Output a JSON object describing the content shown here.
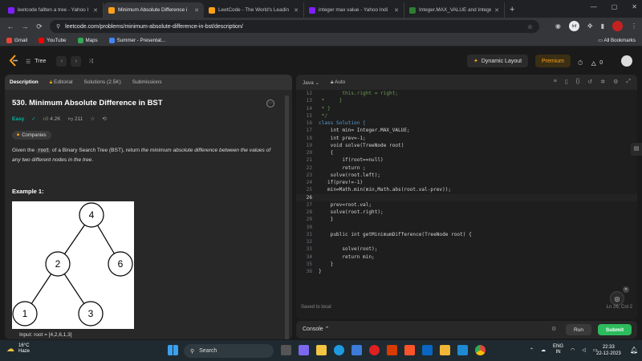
{
  "browser": {
    "tabs": [
      {
        "title": "leetcode fallten a tree - Yahoo I",
        "favicon_color": "#7e1fff",
        "active": false
      },
      {
        "title": "Minimum Absolute Difference i",
        "favicon_color": "#ffa116",
        "active": true
      },
      {
        "title": "LeetCode - The World's Leadin",
        "favicon_color": "#ffa116",
        "active": false
      },
      {
        "title": "integer max value - Yahoo Indi",
        "favicon_color": "#7e1fff",
        "active": false
      },
      {
        "title": "Integer.MAX_VALUE and Intege",
        "favicon_color": "#2e7d32",
        "active": false
      }
    ],
    "new_tab": "+",
    "url": "leetcode.com/problems/minimum-absolute-difference-in-bst/description/",
    "bookmarks": [
      "Gmail",
      "YouTube",
      "Maps",
      "Summer - Presentat..."
    ],
    "all_bookmarks": "All Bookmarks",
    "profile_initials": "Inf"
  },
  "header": {
    "problem_list": "Tree",
    "dynamic_layout": "Dynamic Layout",
    "premium": "Premium",
    "coins": "0"
  },
  "left": {
    "tabs": [
      "Description",
      "Editorial",
      "Solutions (2.5K)",
      "Submissions"
    ],
    "title": "530. Minimum Absolute Difference in BST",
    "difficulty": "Easy",
    "likes": "4.2K",
    "dislikes": "211",
    "companies": "Companies",
    "desc_pre": "Given the ",
    "desc_code": "root",
    "desc_mid": " of a Binary Search Tree (BST), return ",
    "desc_em": "the minimum absolute difference between the values of any two different nodes in the tree",
    "desc_post": ".",
    "example_title": "Example 1:",
    "tree_nodes": [
      "4",
      "2",
      "6",
      "1",
      "3"
    ],
    "input_peek": "Input: root = [4,2,6,1,3]"
  },
  "editor": {
    "language": "Java",
    "mode": "Auto",
    "saved": "Saved to local",
    "cursor": "Ln 26, Col 2",
    "lines": [
      {
        "n": "12",
        "t": "        this.right = right;",
        "c": "cm"
      },
      {
        "n": "13",
        "t": " *     }",
        "c": "cm"
      },
      {
        "n": "14",
        "t": " * }",
        "c": "cm"
      },
      {
        "n": "15",
        "t": " */",
        "c": "cm"
      },
      {
        "n": "16",
        "t": "class Solution {",
        "c": "kw"
      },
      {
        "n": "17",
        "t": "    int min= Integer.MAX_VALUE;",
        "c": "tx"
      },
      {
        "n": "18",
        "t": "    int prev=-1;",
        "c": "tx"
      },
      {
        "n": "19",
        "t": "    void solve(TreeNode root)",
        "c": "tx"
      },
      {
        "n": "20",
        "t": "    {",
        "c": "tx"
      },
      {
        "n": "21",
        "t": "        if(root==null)",
        "c": "tx"
      },
      {
        "n": "22",
        "t": "        return ;",
        "c": "tx"
      },
      {
        "n": "23",
        "t": "    solve(root.left);",
        "c": "tx"
      },
      {
        "n": "24",
        "t": "   if(prev!=-1)",
        "c": "tx"
      },
      {
        "n": "25",
        "t": "   min=Math.min(min,Math.abs(root.val-prev));",
        "c": "tx"
      },
      {
        "n": "26",
        "t": "",
        "c": "tx"
      },
      {
        "n": "27",
        "t": "    prev=root.val;",
        "c": "tx"
      },
      {
        "n": "28",
        "t": "    solve(root.right);",
        "c": "tx"
      },
      {
        "n": "29",
        "t": "    }",
        "c": "tx"
      },
      {
        "n": "30",
        "t": "",
        "c": "tx"
      },
      {
        "n": "31",
        "t": "    public int getMinimumDifference(TreeNode root) {",
        "c": "tx"
      },
      {
        "n": "32",
        "t": "",
        "c": "tx"
      },
      {
        "n": "33",
        "t": "        solve(root);",
        "c": "tx"
      },
      {
        "n": "34",
        "t": "        return min;",
        "c": "tx"
      },
      {
        "n": "35",
        "t": "    }",
        "c": "tx"
      },
      {
        "n": "36",
        "t": "}",
        "c": "tx"
      }
    ]
  },
  "console": {
    "label": "Console",
    "run": "Run",
    "submit": "Submit"
  },
  "taskbar": {
    "temp": "16°C",
    "weather": "Haze",
    "search": "Search",
    "lang": "ENG",
    "region": "IN",
    "time": "22:33",
    "date": "22-12-2023"
  }
}
